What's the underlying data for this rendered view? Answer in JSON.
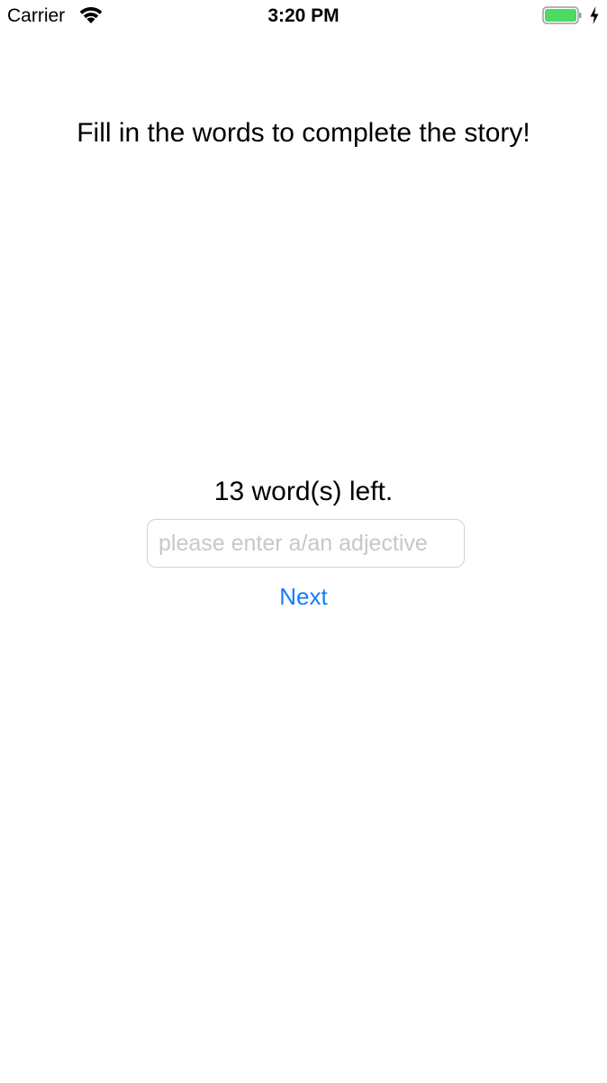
{
  "status_bar": {
    "carrier": "Carrier",
    "time": "3:20 PM",
    "wifi_icon": "wifi-icon",
    "battery_icon": "battery-icon",
    "charging_icon": "charging-bolt-icon",
    "battery_level": 1.0,
    "battery_color": "#4cd964"
  },
  "main": {
    "headline": "Fill in the words to complete the story!",
    "words_left": "13 word(s) left.",
    "input": {
      "value": "",
      "placeholder": "please enter a/an adjective"
    },
    "next_label": "Next"
  },
  "colors": {
    "accent": "#147efb",
    "placeholder": "#c7c7cd",
    "input_border": "#d3d3d3"
  }
}
